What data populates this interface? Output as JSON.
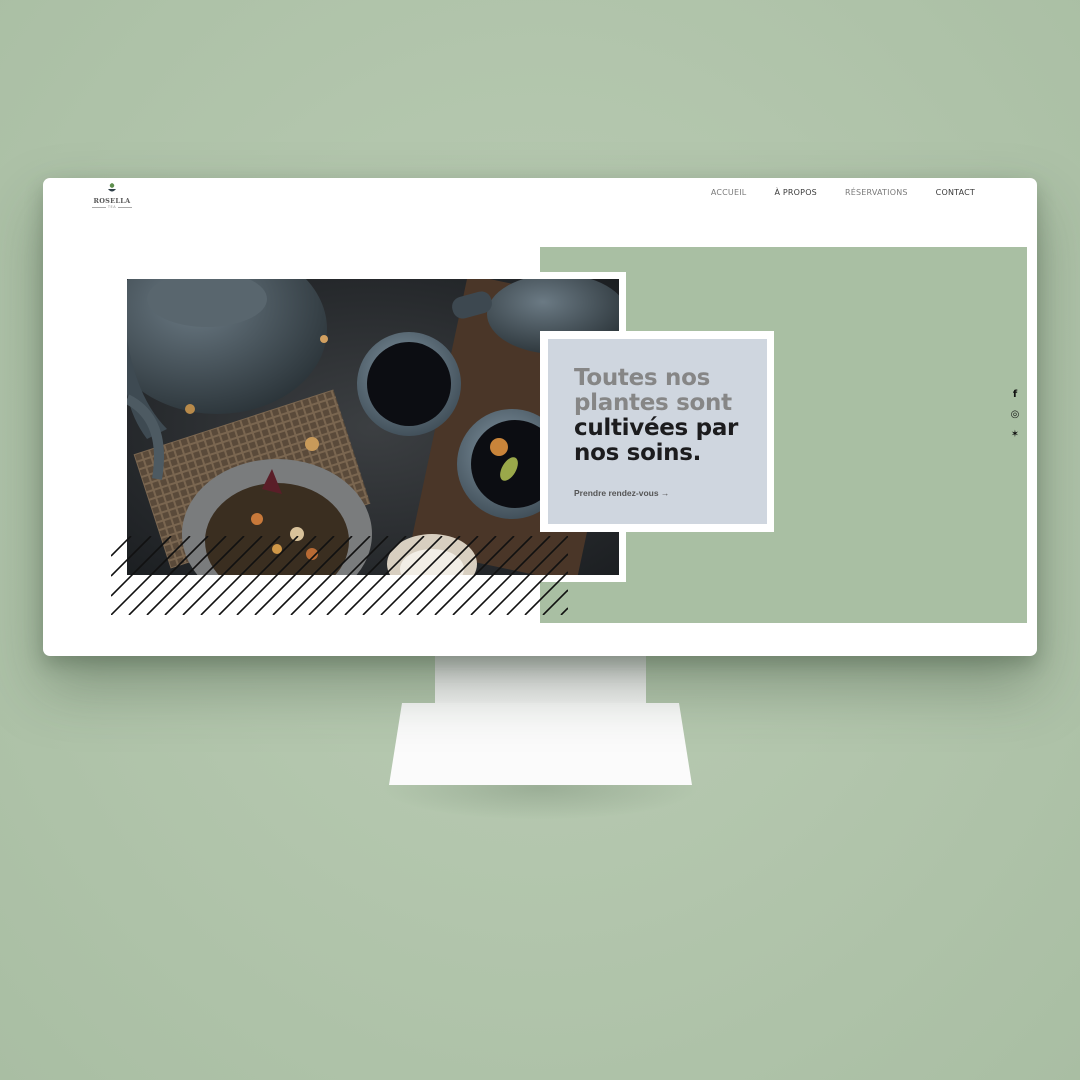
{
  "brand": {
    "name": "ROSELLA",
    "tagline": "TEA"
  },
  "nav": {
    "items": [
      {
        "label": "ACCUEIL"
      },
      {
        "label": "À PROPOS"
      },
      {
        "label": "RÉSERVATIONS"
      },
      {
        "label": "CONTACT"
      }
    ]
  },
  "hero": {
    "headline_line1": "Toutes nos plantes sont",
    "headline_line2": "cultivées par nos soins.",
    "cta_label": "Prendre rendez-vous →"
  },
  "social": {
    "icons": [
      "facebook-icon",
      "instagram-icon",
      "yelp-icon"
    ],
    "glyphs": [
      "f",
      "◎",
      "✶"
    ]
  },
  "colors": {
    "background": "#b3c6ad",
    "panel_green": "#a9bfa3",
    "card": "#cfd6df",
    "headline_gray": "#868686",
    "headline_dark": "#1c1c1e"
  }
}
